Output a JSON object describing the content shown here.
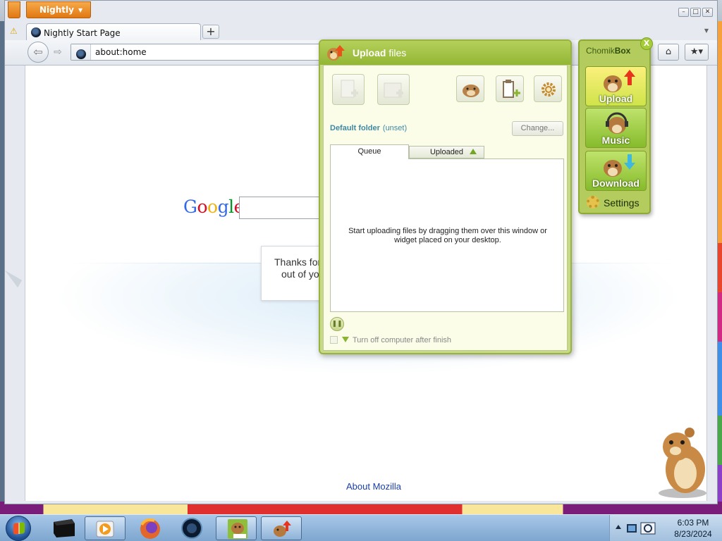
{
  "browser": {
    "app_menu_label": "Nightly",
    "tab_title": "Nightly Start Page",
    "new_tab_label": "+",
    "url": "about:home"
  },
  "page": {
    "google_logo": [
      "G",
      "o",
      "o",
      "g",
      "l",
      "e"
    ],
    "snippet_line1": "Thanks for",
    "snippet_line2": "out of you",
    "about_link": "About Mozilla"
  },
  "upload_dialog": {
    "title_bold": "Upload",
    "title_rest": "files",
    "default_folder_label": "Default folder",
    "default_folder_value": "(unset)",
    "change_button": "Change...",
    "tabs": [
      "Queue",
      "Uploaded"
    ],
    "empty_hint": "Start uploading files by dragging them over this window or widget placed on your desktop.",
    "shutdown_label": "Turn off computer after finish",
    "pause_icon": "pause-icon"
  },
  "chomikbox": {
    "brand_regular": "Chomik",
    "brand_bold": "Box",
    "close_label": "X",
    "buttons": [
      "Upload",
      "Music",
      "Download"
    ],
    "settings_label": "Settings"
  },
  "taskbar": {
    "time": "6:03 PM",
    "date": "8/23/2024"
  },
  "colors": {
    "accent_green": "#98b43c",
    "nightly_orange": "#e07812",
    "link_blue": "#1a3fa8"
  }
}
